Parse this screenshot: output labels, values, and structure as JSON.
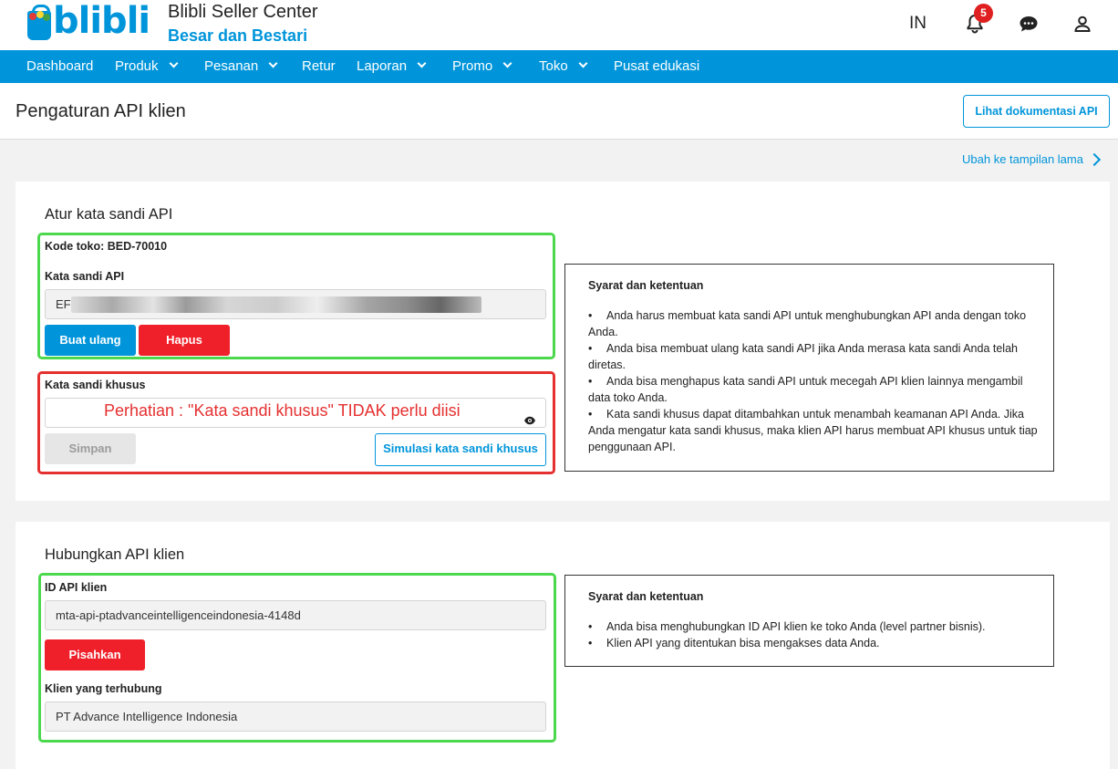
{
  "header": {
    "logo_text": "blibli",
    "brand_title": "Blibli Seller Center",
    "brand_subtitle": "Besar dan Bestari",
    "language": "IN",
    "notification_count": "5"
  },
  "nav": {
    "items": [
      {
        "label": "Dashboard",
        "has_dropdown": false
      },
      {
        "label": "Produk",
        "has_dropdown": true
      },
      {
        "label": "Pesanan",
        "has_dropdown": true
      },
      {
        "label": "Retur",
        "has_dropdown": false
      },
      {
        "label": "Laporan",
        "has_dropdown": true
      },
      {
        "label": "Promo",
        "has_dropdown": true
      },
      {
        "label": "Toko",
        "has_dropdown": true
      },
      {
        "label": "Pusat edukasi",
        "has_dropdown": false
      }
    ]
  },
  "page": {
    "title": "Pengaturan API klien",
    "doc_button": "Lihat dokumentasi API",
    "old_view_link": "Ubah ke tampilan lama"
  },
  "password_section": {
    "title": "Atur kata sandi API",
    "store_code": "Kode toko: BED-70010",
    "api_password_label": "Kata sandi API",
    "api_password_value": "EF",
    "regenerate_button": "Buat ulang",
    "delete_button": "Hapus",
    "custom_password_label": "Kata sandi khusus",
    "custom_password_warning": "Perhatian : \"Kata sandi khusus\" TIDAK perlu diisi",
    "save_button": "Simpan",
    "simulate_button": "Simulasi kata sandi khusus",
    "terms": {
      "title": "Syarat dan ketentuan",
      "items": [
        "Anda harus membuat kata sandi API untuk menghubungkan API anda dengan toko Anda.",
        "Anda bisa membuat ulang kata sandi API jika Anda merasa kata sandi Anda telah diretas.",
        "Anda bisa menghapus kata sandi API untuk mecegah API klien lainnya mengambil data toko Anda.",
        "Kata sandi khusus dapat ditambahkan untuk menambah keamanan API Anda. Jika Anda mengatur kata sandi khusus, maka klien API harus membuat API khusus untuk tiap penggunaan API."
      ]
    }
  },
  "client_section": {
    "title": "Hubungkan API klien",
    "client_id_label": "ID API klien",
    "client_id_value": "mta-api-ptadvanceintelligenceindonesia-4148d",
    "disconnect_button": "Pisahkan",
    "connected_client_label": "Klien yang terhubung",
    "connected_client_value": "PT Advance Intelligence Indonesia",
    "terms": {
      "title": "Syarat dan ketentuan",
      "items": [
        "Anda bisa menghubungkan ID API klien ke toko Anda (level partner bisnis).",
        "Klien API yang ditentukan bisa mengakses data Anda."
      ]
    }
  },
  "colors": {
    "brand_blue": "#0095da",
    "danger_red": "#f0202a",
    "highlight_green": "#4cd84c",
    "highlight_red": "#e53030"
  }
}
